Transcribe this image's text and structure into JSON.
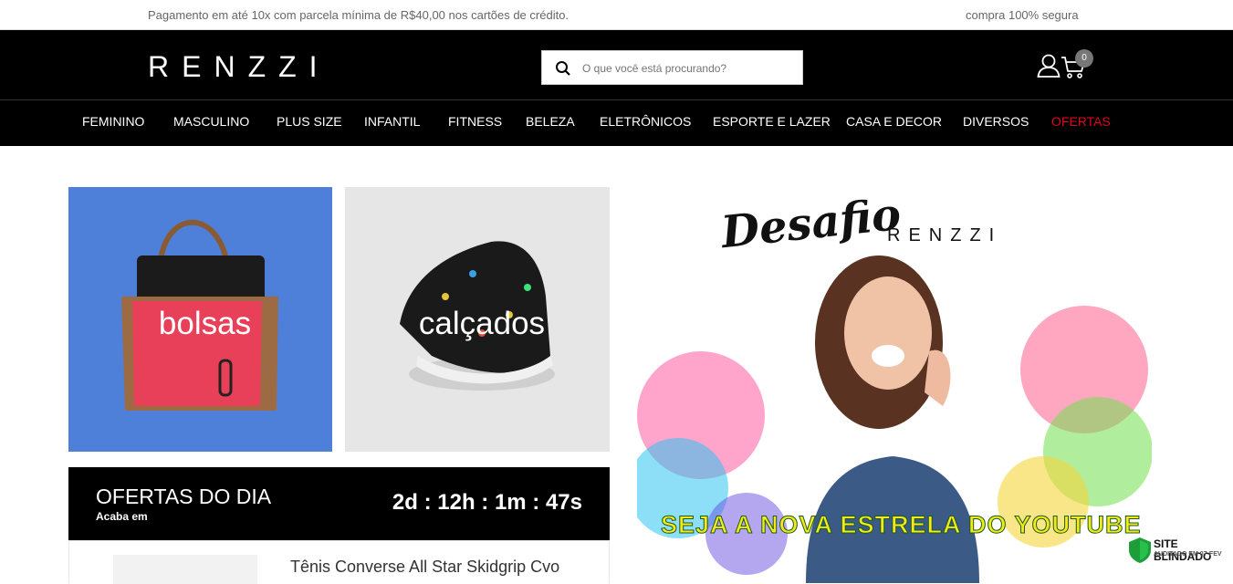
{
  "topbar": {
    "installment_text": "Pagamento em até 10x com parcela mínima de R$40,00 nos cartões de crédito.",
    "secure_text": "compra 100% segura"
  },
  "header": {
    "logo": "RENZZI",
    "search_placeholder": "O que você está procurando?",
    "cart_count": "0"
  },
  "nav": {
    "items": [
      "FEMININO",
      "MASCULINO",
      "PLUS SIZE",
      "INFANTIL",
      "FITNESS",
      "BELEZA",
      "ELETRÔNICOS",
      "ESPORTE E LAZER",
      "CASA E DECOR",
      "DIVERSOS",
      "OFERTAS"
    ]
  },
  "categories": [
    {
      "label": "bolsas"
    },
    {
      "label": "calçados"
    }
  ],
  "offers": {
    "title": "OFERTAS DO DIA",
    "subtitle": "Acaba em",
    "timer": "2d : 12h : 1m : 47s"
  },
  "product": {
    "name": "Tênis Converse All Star Skidgrip Cvo"
  },
  "banner": {
    "script_title": "Desafio",
    "brand": "RENZZI",
    "slogan": "SEJA A NOVA ESTRELA DO YOUTUBE"
  },
  "seal": {
    "title": "SITE BLINDADO",
    "subtitle": "AUDITADO EM 07-FEV"
  },
  "colors": {
    "accent_red": "#e2001a",
    "bag_bg": "#4f80d9",
    "shoe_bg": "#e6e6e6",
    "slogan_yellow": "#f5e81c"
  }
}
